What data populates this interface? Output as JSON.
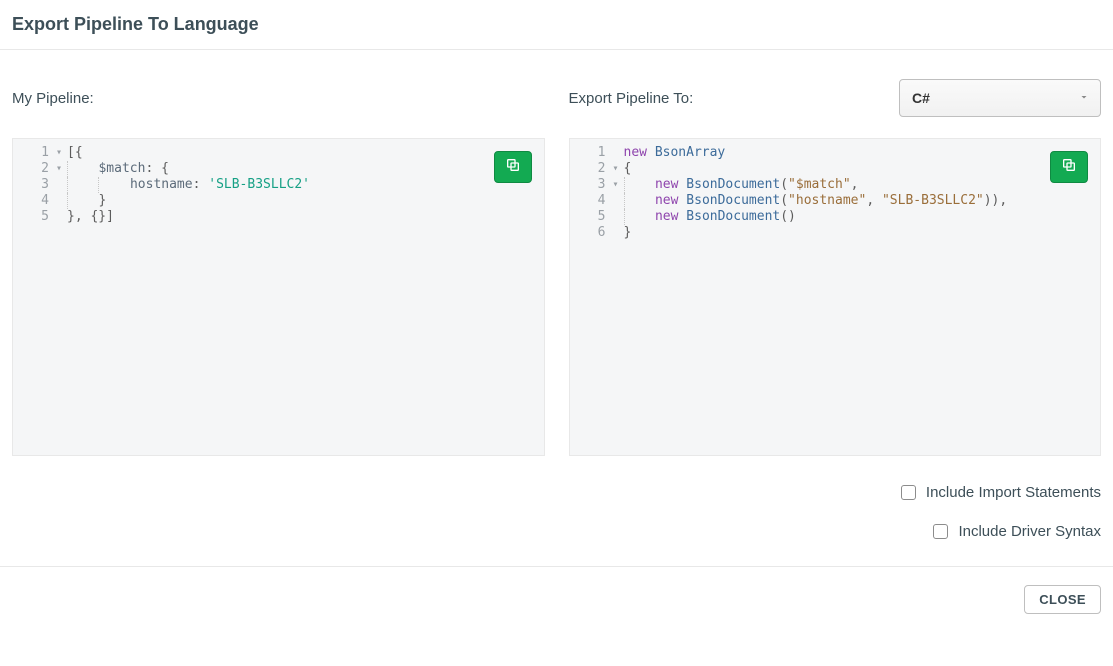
{
  "dialog_title": "Export Pipeline To Language",
  "left_label": "My Pipeline:",
  "right_label": "Export Pipeline To:",
  "language_selected": "C#",
  "source_lines": [
    {
      "n": "1",
      "fold": "▾",
      "tokens": [
        {
          "t": "[{",
          "c": "t-brace"
        }
      ]
    },
    {
      "n": "2",
      "fold": "▾",
      "indent": 1,
      "tokens": [
        {
          "t": "$match",
          "c": "t-key"
        },
        {
          "t": ": ",
          "c": "t-op"
        },
        {
          "t": "{",
          "c": "t-brace"
        }
      ]
    },
    {
      "n": "3",
      "fold": "",
      "indent": 2,
      "tokens": [
        {
          "t": "hostname",
          "c": "t-key"
        },
        {
          "t": ": ",
          "c": "t-op"
        },
        {
          "t": "'SLB-B3SLLC2'",
          "c": "t-str"
        }
      ]
    },
    {
      "n": "4",
      "fold": "",
      "indent": 1,
      "tokens": [
        {
          "t": "}",
          "c": "t-brace"
        }
      ]
    },
    {
      "n": "5",
      "fold": "",
      "tokens": [
        {
          "t": "}, {}]",
          "c": "t-brace"
        }
      ]
    }
  ],
  "output_lines": [
    {
      "n": "1",
      "fold": "",
      "tokens": [
        {
          "t": "new ",
          "c": "t-kw"
        },
        {
          "t": "BsonArray",
          "c": "t-cls"
        }
      ]
    },
    {
      "n": "2",
      "fold": "▾",
      "tokens": [
        {
          "t": "{",
          "c": "t-brace"
        }
      ]
    },
    {
      "n": "3",
      "fold": "▾",
      "indent": 1,
      "tokens": [
        {
          "t": "new ",
          "c": "t-kw"
        },
        {
          "t": "BsonDocument",
          "c": "t-cls"
        },
        {
          "t": "(",
          "c": "t-op"
        },
        {
          "t": "\"$match\"",
          "c": "t-str2"
        },
        {
          "t": ",",
          "c": "t-op"
        }
      ]
    },
    {
      "n": "4",
      "fold": "",
      "indent": 1,
      "tokens": [
        {
          "t": "new ",
          "c": "t-kw"
        },
        {
          "t": "BsonDocument",
          "c": "t-cls"
        },
        {
          "t": "(",
          "c": "t-op"
        },
        {
          "t": "\"hostname\"",
          "c": "t-str2"
        },
        {
          "t": ", ",
          "c": "t-op"
        },
        {
          "t": "\"SLB-B3SLLC2\"",
          "c": "t-str2"
        },
        {
          "t": ")),",
          "c": "t-op"
        }
      ]
    },
    {
      "n": "5",
      "fold": "",
      "indent": 1,
      "tokens": [
        {
          "t": "new ",
          "c": "t-kw"
        },
        {
          "t": "BsonDocument",
          "c": "t-cls"
        },
        {
          "t": "()",
          "c": "t-op"
        }
      ]
    },
    {
      "n": "6",
      "fold": "",
      "tokens": [
        {
          "t": "}",
          "c": "t-brace"
        }
      ]
    }
  ],
  "checkbox_imports": "Include Import Statements",
  "checkbox_driver": "Include Driver Syntax",
  "close_label": "CLOSE"
}
